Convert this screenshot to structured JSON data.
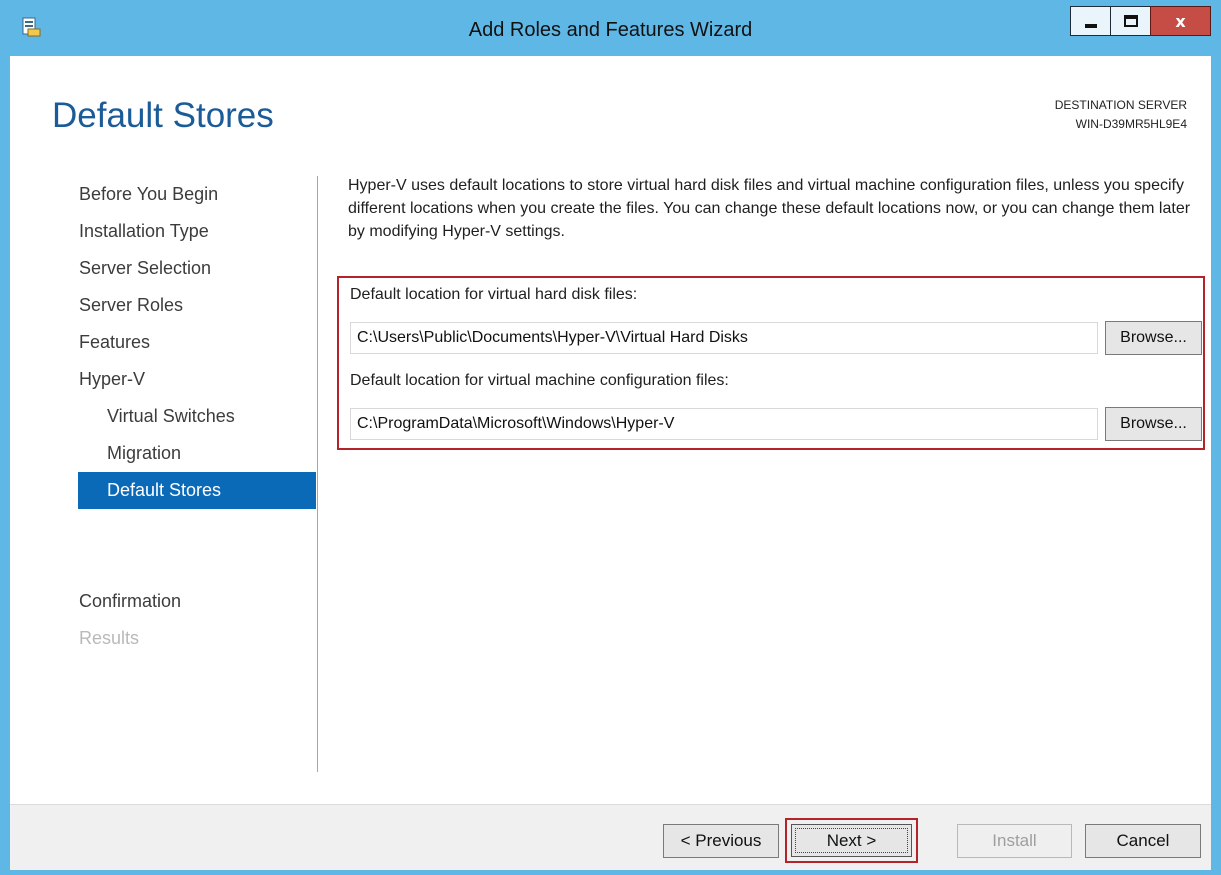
{
  "window": {
    "title": "Add Roles and Features Wizard",
    "buttons": {
      "minimize": "minimize",
      "maximize": "maximize",
      "close": "x"
    },
    "frame_color": "#5fb7e6"
  },
  "header": {
    "page_title": "Default Stores",
    "destination_label": "DESTINATION SERVER",
    "destination_server": "WIN-D39MR5HL9E4"
  },
  "nav": {
    "items": [
      {
        "label": "Before You Begin",
        "state": "normal"
      },
      {
        "label": "Installation Type",
        "state": "normal"
      },
      {
        "label": "Server Selection",
        "state": "normal"
      },
      {
        "label": "Server Roles",
        "state": "normal"
      },
      {
        "label": "Features",
        "state": "normal"
      },
      {
        "label": "Hyper-V",
        "state": "normal"
      },
      {
        "label": "Virtual Switches",
        "state": "sub"
      },
      {
        "label": "Migration",
        "state": "sub"
      },
      {
        "label": "Default Stores",
        "state": "active"
      },
      {
        "label": "Confirmation",
        "state": "normal"
      },
      {
        "label": "Results",
        "state": "disabled"
      }
    ]
  },
  "content": {
    "intro": "Hyper-V uses default locations to store virtual hard disk files and virtual machine configuration files, unless you specify different locations when you create the files. You can change these default locations now, or you can change them later by modifying Hyper-V settings.",
    "vhd_label": "Default location for virtual hard disk files:",
    "vhd_path": "C:\\Users\\Public\\Documents\\Hyper-V\\Virtual Hard Disks",
    "config_label": "Default location for virtual machine configuration files:",
    "config_path": "C:\\ProgramData\\Microsoft\\Windows\\Hyper-V",
    "browse_label": "Browse..."
  },
  "footer": {
    "previous": "< Previous",
    "next": "Next >",
    "install": "Install",
    "cancel": "Cancel"
  },
  "colors": {
    "accent_blue": "#0a6ab8",
    "title_blue": "#1a5b98",
    "highlight_red": "#b4222a"
  }
}
